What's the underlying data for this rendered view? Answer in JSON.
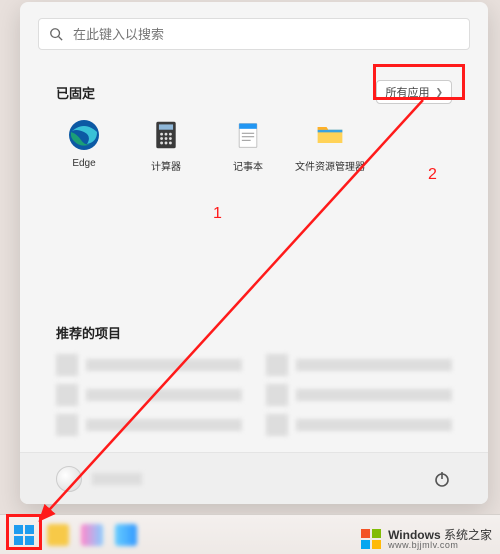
{
  "search": {
    "placeholder": "在此键入以搜索"
  },
  "pinned": {
    "title": "已固定",
    "all_apps_label": "所有应用",
    "items": [
      {
        "label": "Edge",
        "icon": "edge-icon"
      },
      {
        "label": "计算器",
        "icon": "calculator-icon"
      },
      {
        "label": "记事本",
        "icon": "notepad-icon"
      },
      {
        "label": "文件资源管理器",
        "icon": "file-explorer-icon"
      }
    ]
  },
  "recommended": {
    "title": "推荐的项目"
  },
  "annotations": {
    "label1": "1",
    "label2": "2",
    "arrow_color": "#ff1a1a"
  },
  "watermark": {
    "brand": "Windows",
    "sub": "系统之家",
    "url": "www.bjjmlv.com"
  }
}
